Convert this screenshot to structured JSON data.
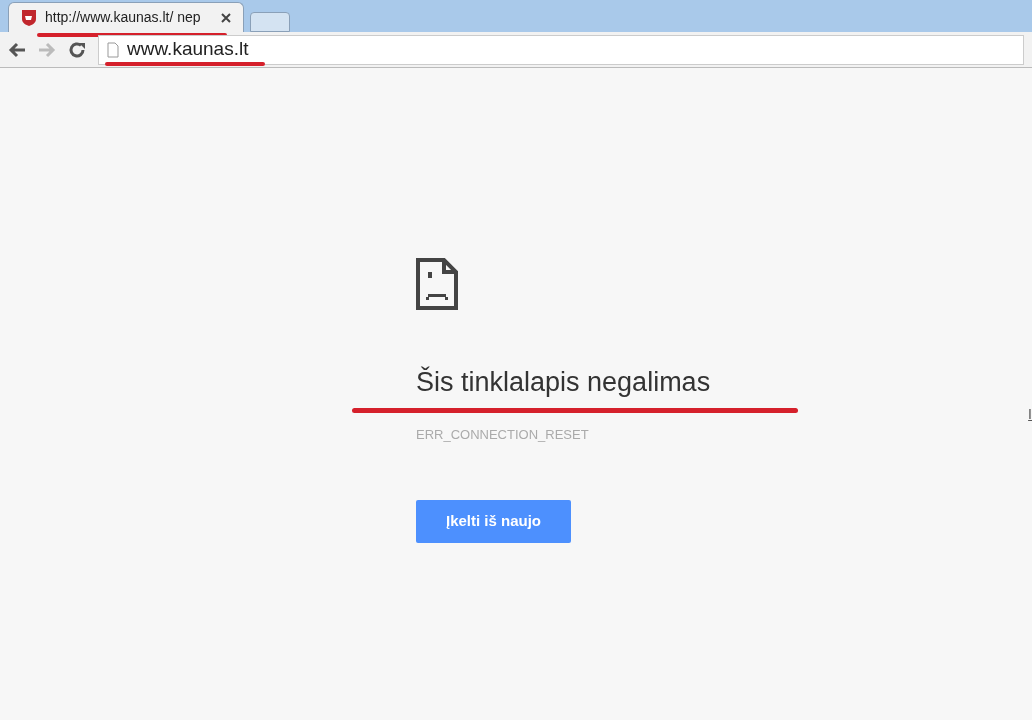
{
  "tabs": [
    {
      "kind": "page",
      "title": "http://www.kaunas.lt/ nep",
      "selected": true
    },
    {
      "kind": "new",
      "selected": false
    }
  ],
  "toolbar": {
    "address": "www.kaunas.lt"
  },
  "error": {
    "heading": "Šis tinklalapis negalimas",
    "code": "ERR_CONNECTION_RESET",
    "button": "Įkelti iš naujo",
    "side_link": "I"
  }
}
